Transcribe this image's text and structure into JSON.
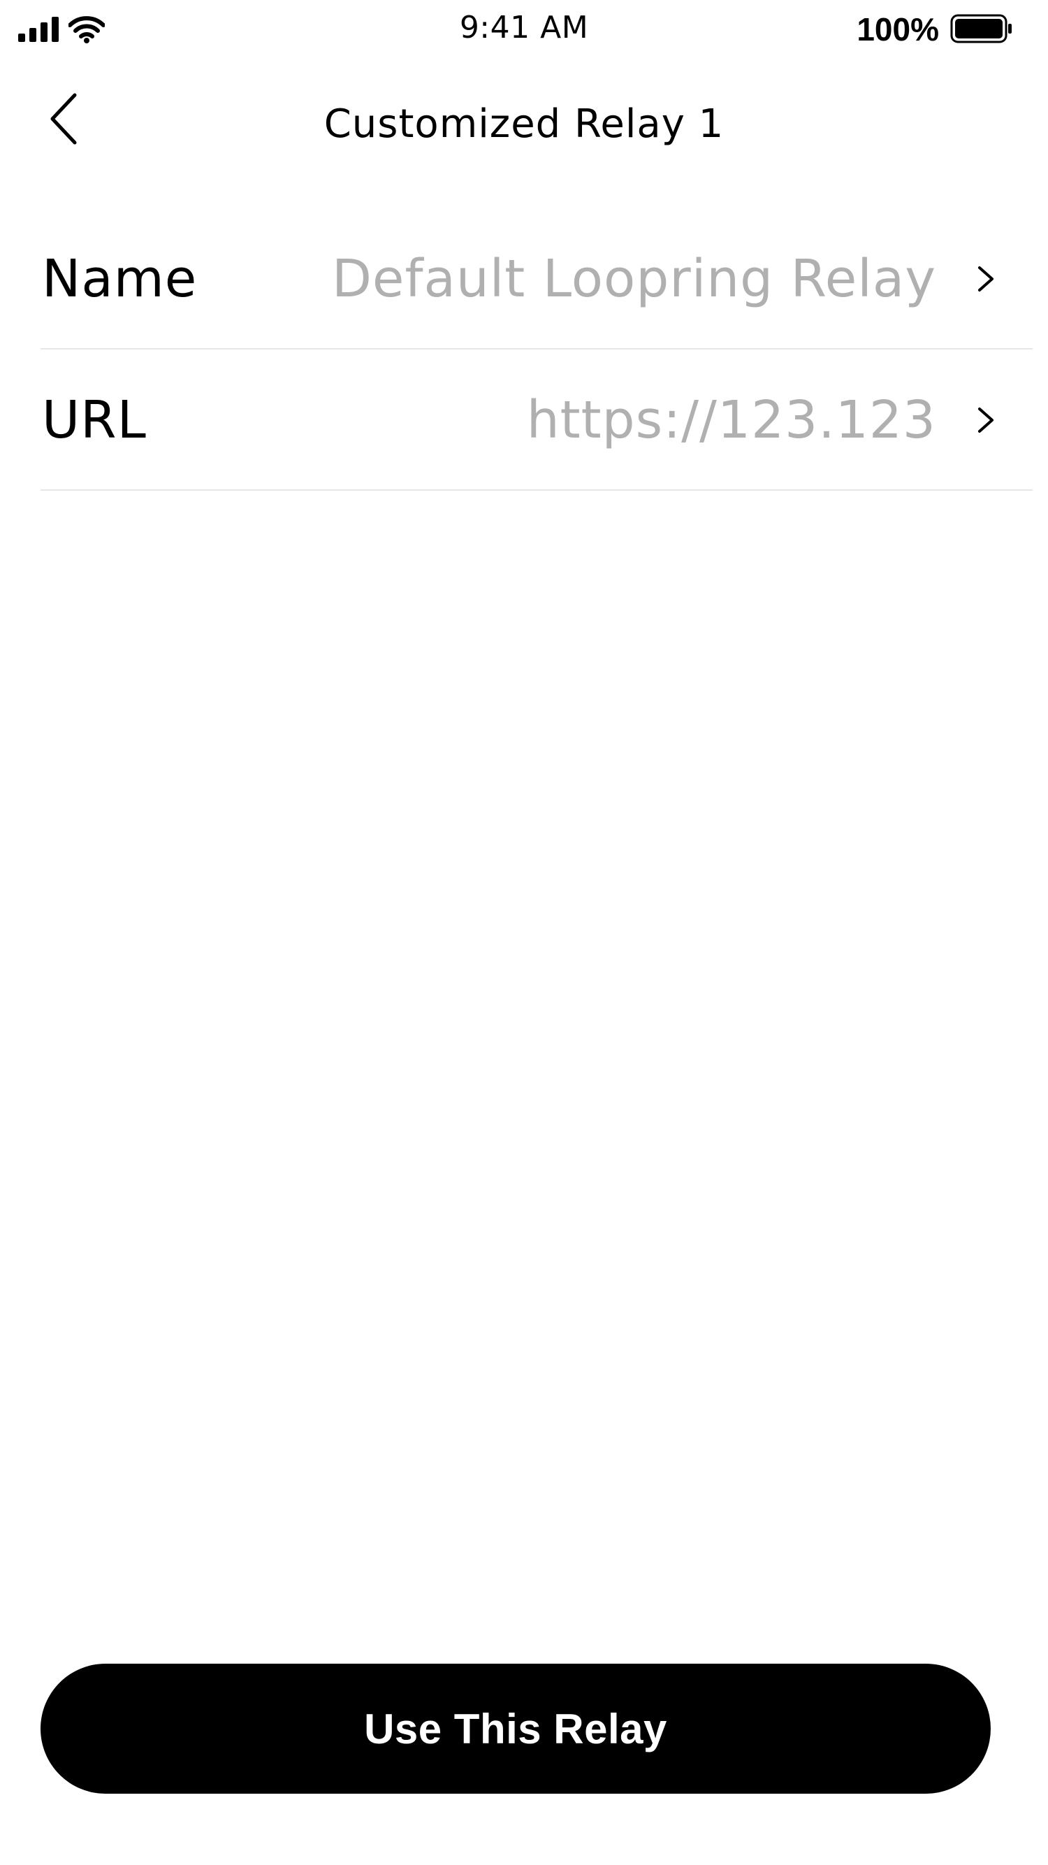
{
  "status_bar": {
    "time": "9:41 AM",
    "battery_percent": "100%",
    "icons": [
      "cellular-signal-icon",
      "wifi-icon",
      "battery-icon"
    ]
  },
  "nav": {
    "title": "Customized Relay 1",
    "back_icon": "chevron-left-icon"
  },
  "form": {
    "rows": [
      {
        "label": "Name",
        "value": "Default Loopring Relay",
        "icon": "chevron-right-icon"
      },
      {
        "label": "URL",
        "value": "https://123.123",
        "icon": "chevron-right-icon"
      }
    ]
  },
  "actions": {
    "primary_label": "Use This Relay"
  },
  "colors": {
    "background": "#ffffff",
    "text": "#000000",
    "value_text": "#b0b0b0",
    "divider": "#e6e6e6",
    "button_bg": "#000000",
    "button_text": "#ffffff"
  }
}
